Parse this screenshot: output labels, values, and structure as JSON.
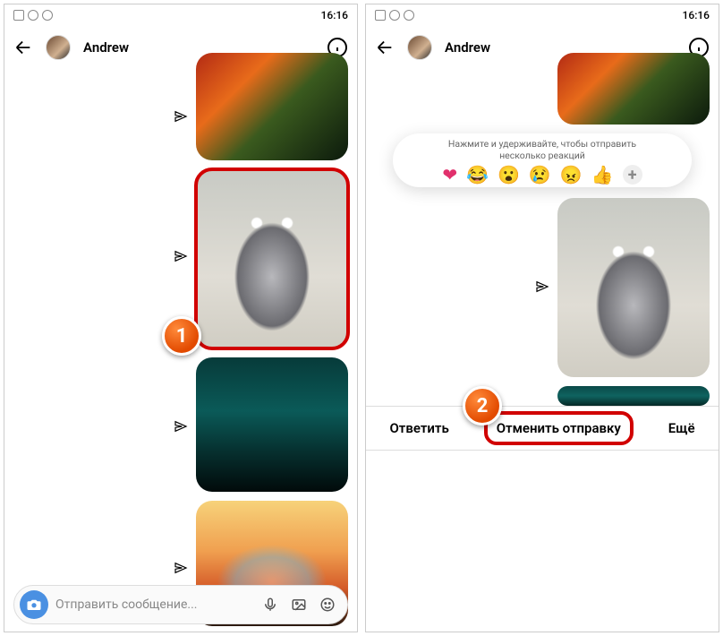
{
  "status": {
    "time": "16:16"
  },
  "chat": {
    "name": "Andrew"
  },
  "composer": {
    "placeholder": "Отправить сообщение..."
  },
  "reactions": {
    "hint_line1": "Нажмите  и удерживайте, чтобы отправить",
    "hint_line2": "несколько реакций"
  },
  "actions": {
    "reply": "Ответить",
    "unsend": "Отменить отправку",
    "more": "Ещё"
  },
  "steps": {
    "s1": "1",
    "s2": "2"
  }
}
